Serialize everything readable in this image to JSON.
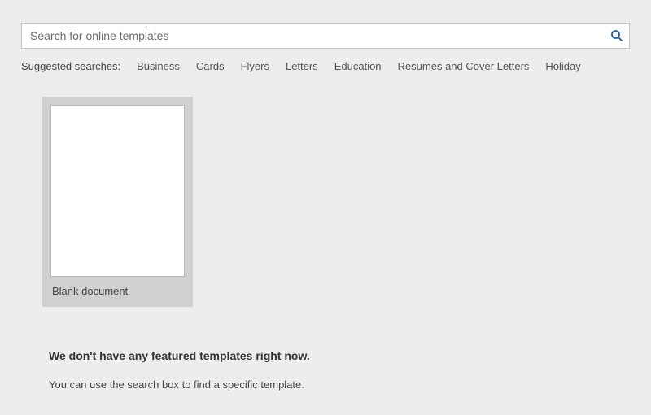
{
  "search": {
    "placeholder": "Search for online templates",
    "value": ""
  },
  "suggested": {
    "label": "Suggested searches:",
    "items": [
      "Business",
      "Cards",
      "Flyers",
      "Letters",
      "Education",
      "Resumes and Cover Letters",
      "Holiday"
    ]
  },
  "templates": {
    "blank_label": "Blank document"
  },
  "messages": {
    "no_featured": "We don't have any featured templates right now.",
    "hint": "You can use the search box to find a specific template."
  },
  "colors": {
    "accent": "#1f5aa6",
    "background": "#ededed",
    "tile": "#d0d0d0"
  }
}
